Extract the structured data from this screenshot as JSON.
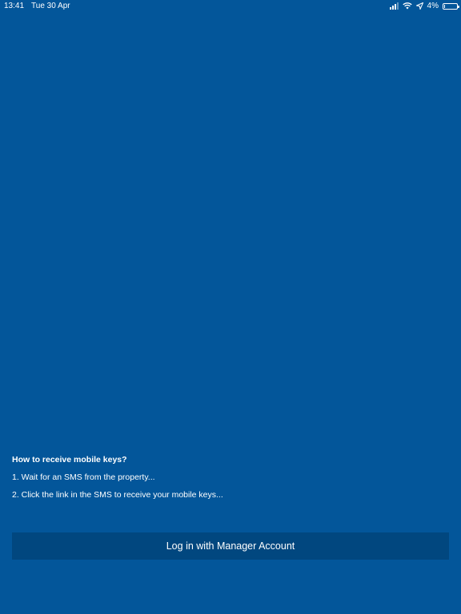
{
  "status_bar": {
    "time": "13:41",
    "date": "Tue 30 Apr",
    "battery_percent": "4%",
    "battery_level": 0.04,
    "icons": [
      "signal-icon",
      "wifi-icon",
      "location-arrow-icon",
      "battery-icon"
    ]
  },
  "info": {
    "title": "How to receive mobile keys?",
    "steps": [
      "1. Wait for an SMS from the property...",
      "2. Click the link in the SMS to receive your mobile keys..."
    ]
  },
  "login_button": {
    "label": "Log in with Manager Account"
  },
  "colors": {
    "background": "#03569a",
    "button": "#01477f",
    "text": "#ffffff"
  }
}
